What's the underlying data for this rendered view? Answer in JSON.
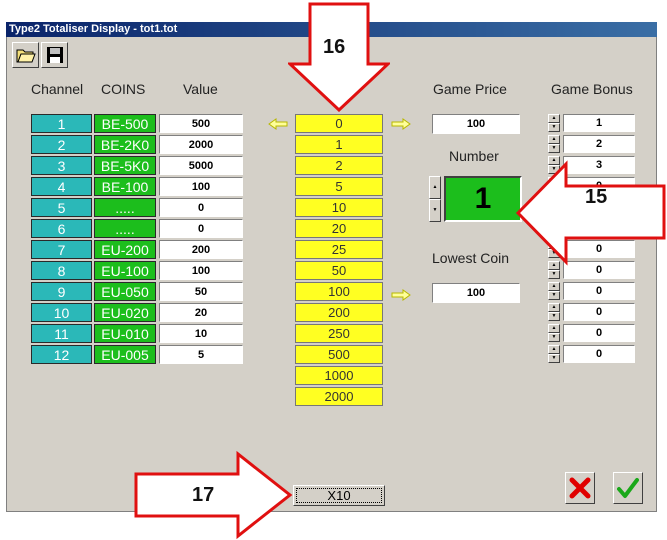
{
  "window": {
    "title": "Type2 Totaliser Display - tot1.tot"
  },
  "toolbar": {
    "open_icon": "folder-open-icon",
    "save_icon": "floppy-disk-icon"
  },
  "headers": {
    "channel": "Channel",
    "coins": "COINS",
    "value": "Value",
    "game_price": "Game Price",
    "game_bonus": "Game Bonus",
    "number": "Number",
    "lowest_coin": "Lowest Coin"
  },
  "channels": [
    {
      "ch": "1",
      "coin": "BE-500",
      "value": "500"
    },
    {
      "ch": "2",
      "coin": "BE-2K0",
      "value": "2000"
    },
    {
      "ch": "3",
      "coin": "BE-5K0",
      "value": "5000"
    },
    {
      "ch": "4",
      "coin": "BE-100",
      "value": "100"
    },
    {
      "ch": "5",
      "coin": ".....",
      "value": "0"
    },
    {
      "ch": "6",
      "coin": ".....",
      "value": "0"
    },
    {
      "ch": "7",
      "coin": "EU-200",
      "value": "200"
    },
    {
      "ch": "8",
      "coin": "EU-100",
      "value": "100"
    },
    {
      "ch": "9",
      "coin": "EU-050",
      "value": "50"
    },
    {
      "ch": "10",
      "coin": "EU-020",
      "value": "20"
    },
    {
      "ch": "11",
      "coin": "EU-010",
      "value": "10"
    },
    {
      "ch": "12",
      "coin": "EU-005",
      "value": "5"
    }
  ],
  "middle_values": [
    "0",
    "1",
    "2",
    "5",
    "10",
    "20",
    "25",
    "50",
    "100",
    "200",
    "250",
    "500",
    "1000",
    "2000"
  ],
  "game_price": "100",
  "number": "1",
  "lowest_coin": "100",
  "game_bonus": [
    "1",
    "2",
    "3",
    "0",
    "0",
    "0",
    "0",
    "0",
    "0",
    "0",
    "0",
    "0"
  ],
  "x10_button": "X10",
  "callouts": {
    "c16": "16",
    "c15": "15",
    "c17": "17"
  },
  "colors": {
    "channel": "#2bb8b8",
    "coin": "#1cbe1c",
    "middle": "#ffff22",
    "number_bg": "#1cbe1c",
    "callout_arrow": "#e01010",
    "title_bar": "#0a246a"
  },
  "actions": {
    "cancel_icon": "red-x-cancel-icon",
    "ok_icon": "green-check-ok-icon"
  }
}
